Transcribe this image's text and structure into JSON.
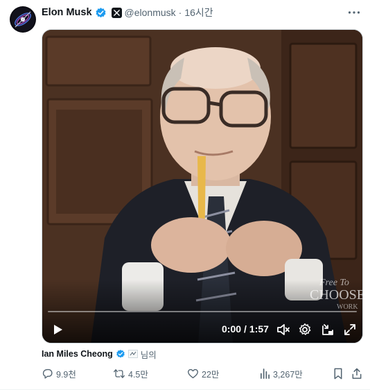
{
  "author": {
    "name": "Elon Musk",
    "handle": "@elonmusk",
    "separator": "·",
    "time": "16시간"
  },
  "menu": {
    "more_label": "···"
  },
  "video": {
    "current_time": "0:00",
    "separator": "/",
    "duration": "1:57",
    "progress_fraction": 0,
    "watermark_line1": "Free To",
    "watermark_line2": "CHOOSE",
    "watermark_line3": "WORK"
  },
  "attribution": {
    "name": "Ian Miles Cheong",
    "suffix": "님의"
  },
  "actions": {
    "replies": "9.9천",
    "reposts": "4.5만",
    "likes": "22만",
    "views": "3,267만"
  },
  "colors": {
    "accent": "#1d9bf0",
    "muted_text": "#536471",
    "text": "#0f1419"
  },
  "icons": [
    "verified-badge-icon",
    "x-affiliate-icon",
    "more-icon",
    "play-icon",
    "mute-icon",
    "settings-icon",
    "pip-icon",
    "fullscreen-icon",
    "reply-icon",
    "repost-icon",
    "like-icon",
    "views-icon",
    "bookmark-icon",
    "share-icon"
  ]
}
